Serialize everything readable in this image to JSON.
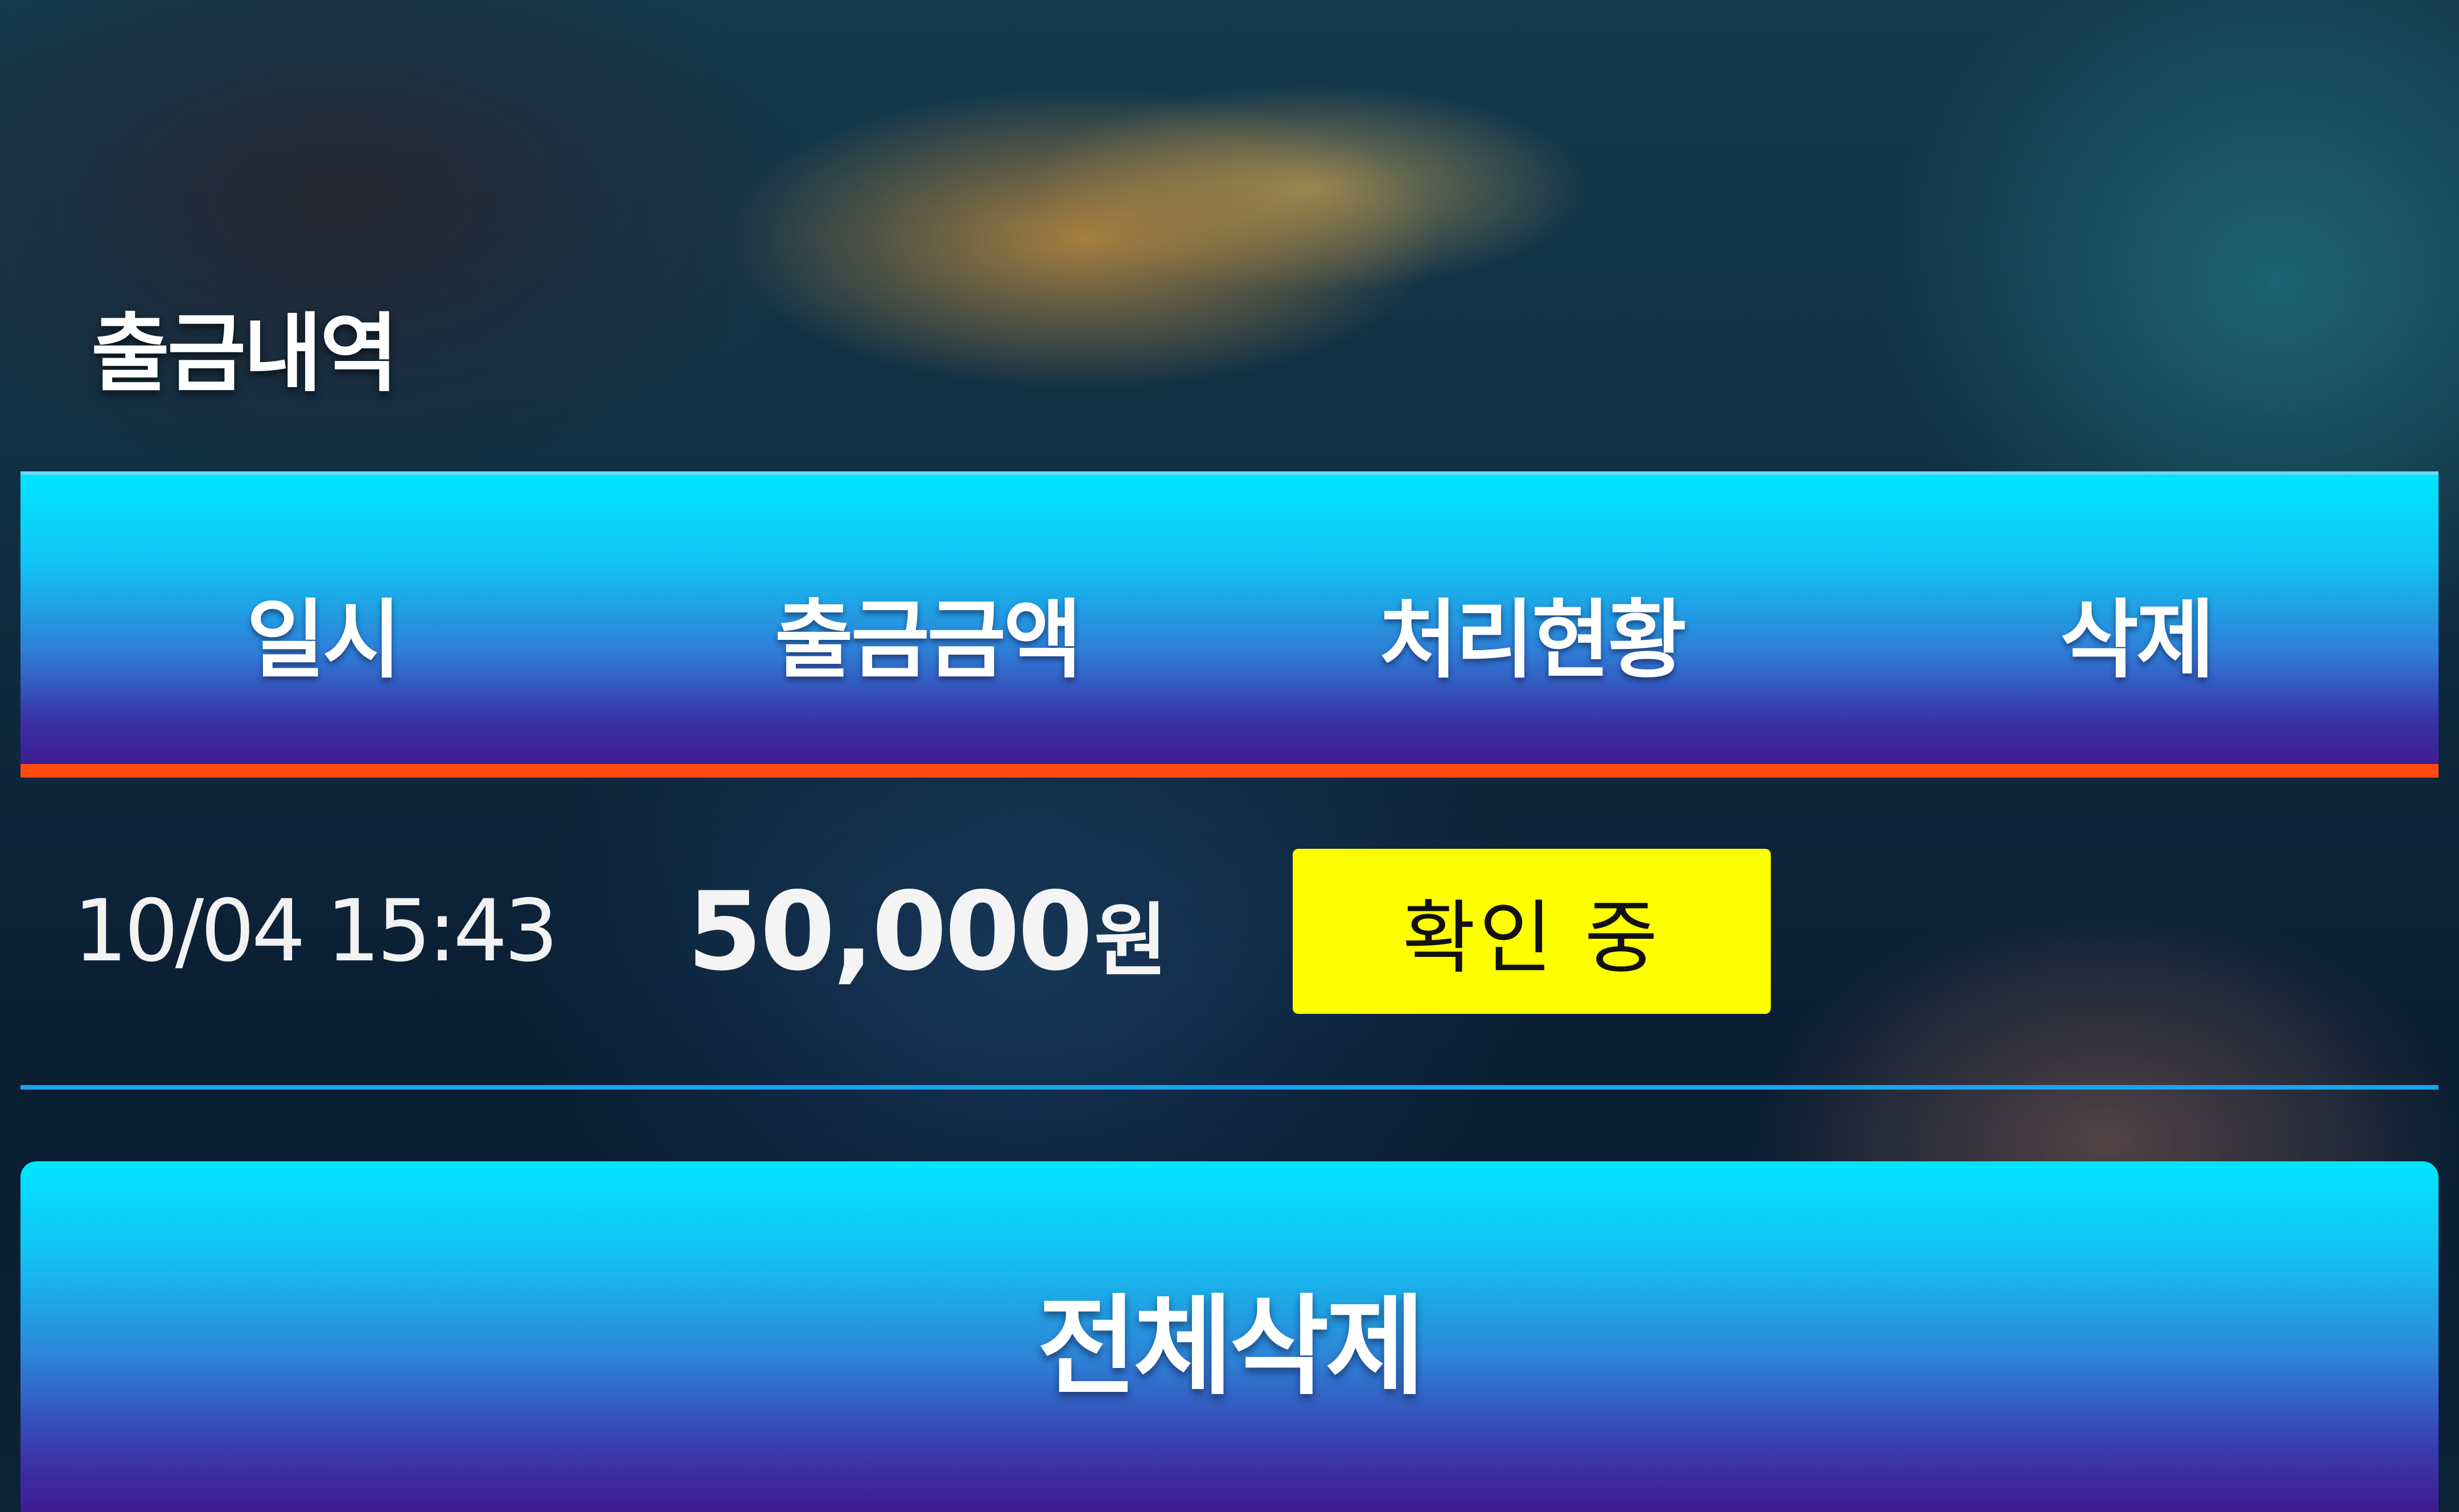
{
  "panel": {
    "title": "출금내역"
  },
  "table": {
    "columns": [
      "일시",
      "출금금액",
      "처리현황",
      "삭제"
    ],
    "rows": [
      {
        "datetime": "10/04 15:43",
        "amount": "50,000",
        "currency": "원",
        "status": "확인 중",
        "delete": ""
      }
    ]
  },
  "actions": {
    "delete_all_label": "전체삭제"
  },
  "colors": {
    "header_top": "#00e6ff",
    "header_bottom": "#3f1b8f",
    "header_underline": "#ff4a12",
    "row_separator": "#1aa3ef",
    "status_badge": "#ffff00"
  }
}
